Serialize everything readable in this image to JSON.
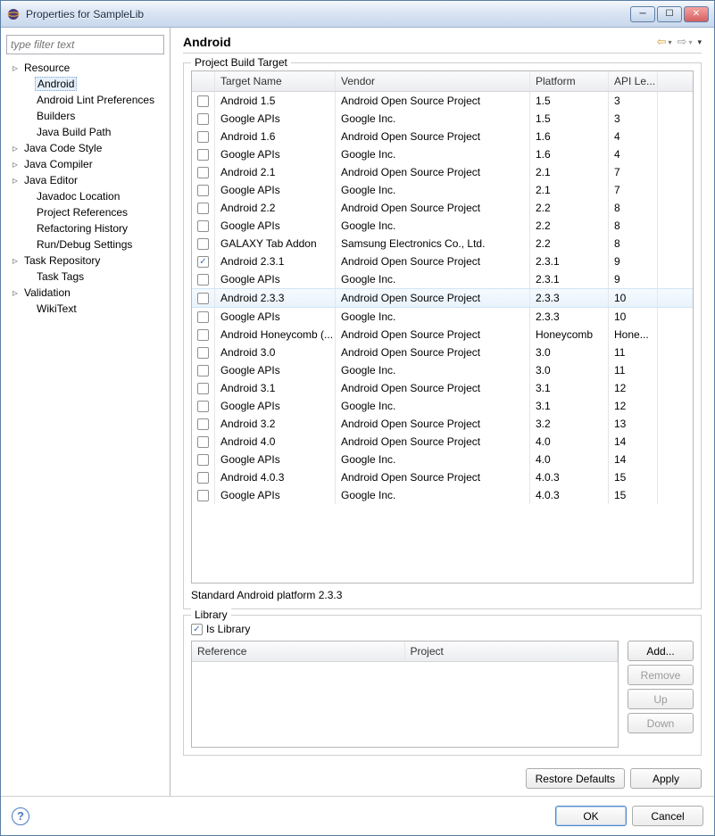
{
  "window": {
    "title": "Properties for SampleLib"
  },
  "sidebar": {
    "filter_placeholder": "type filter text",
    "items": [
      {
        "label": "Resource",
        "level": 1,
        "expand": true,
        "selected": false
      },
      {
        "label": "Android",
        "level": 2,
        "expand": false,
        "selected": true
      },
      {
        "label": "Android Lint Preferences",
        "level": 2,
        "expand": false,
        "selected": false
      },
      {
        "label": "Builders",
        "level": 2,
        "expand": false,
        "selected": false
      },
      {
        "label": "Java Build Path",
        "level": 2,
        "expand": false,
        "selected": false
      },
      {
        "label": "Java Code Style",
        "level": 1,
        "expand": true,
        "selected": false
      },
      {
        "label": "Java Compiler",
        "level": 1,
        "expand": true,
        "selected": false
      },
      {
        "label": "Java Editor",
        "level": 1,
        "expand": true,
        "selected": false
      },
      {
        "label": "Javadoc Location",
        "level": 2,
        "expand": false,
        "selected": false
      },
      {
        "label": "Project References",
        "level": 2,
        "expand": false,
        "selected": false
      },
      {
        "label": "Refactoring History",
        "level": 2,
        "expand": false,
        "selected": false
      },
      {
        "label": "Run/Debug Settings",
        "level": 2,
        "expand": false,
        "selected": false
      },
      {
        "label": "Task Repository",
        "level": 1,
        "expand": true,
        "selected": false
      },
      {
        "label": "Task Tags",
        "level": 2,
        "expand": false,
        "selected": false
      },
      {
        "label": "Validation",
        "level": 1,
        "expand": true,
        "selected": false
      },
      {
        "label": "WikiText",
        "level": 2,
        "expand": false,
        "selected": false
      }
    ]
  },
  "page": {
    "title": "Android",
    "build_target_group": "Project Build Target",
    "columns": {
      "target": "Target Name",
      "vendor": "Vendor",
      "platform": "Platform",
      "api": "API Le..."
    },
    "targets": [
      {
        "checked": false,
        "name": "Android 1.5",
        "vendor": "Android Open Source Project",
        "platform": "1.5",
        "api": "3",
        "hl": false
      },
      {
        "checked": false,
        "name": "Google APIs",
        "vendor": "Google Inc.",
        "platform": "1.5",
        "api": "3",
        "hl": false
      },
      {
        "checked": false,
        "name": "Android 1.6",
        "vendor": "Android Open Source Project",
        "platform": "1.6",
        "api": "4",
        "hl": false
      },
      {
        "checked": false,
        "name": "Google APIs",
        "vendor": "Google Inc.",
        "platform": "1.6",
        "api": "4",
        "hl": false
      },
      {
        "checked": false,
        "name": "Android 2.1",
        "vendor": "Android Open Source Project",
        "platform": "2.1",
        "api": "7",
        "hl": false
      },
      {
        "checked": false,
        "name": "Google APIs",
        "vendor": "Google Inc.",
        "platform": "2.1",
        "api": "7",
        "hl": false
      },
      {
        "checked": false,
        "name": "Android 2.2",
        "vendor": "Android Open Source Project",
        "platform": "2.2",
        "api": "8",
        "hl": false
      },
      {
        "checked": false,
        "name": "Google APIs",
        "vendor": "Google Inc.",
        "platform": "2.2",
        "api": "8",
        "hl": false
      },
      {
        "checked": false,
        "name": "GALAXY Tab Addon",
        "vendor": "Samsung Electronics Co., Ltd.",
        "platform": "2.2",
        "api": "8",
        "hl": false
      },
      {
        "checked": true,
        "name": "Android 2.3.1",
        "vendor": "Android Open Source Project",
        "platform": "2.3.1",
        "api": "9",
        "hl": false
      },
      {
        "checked": false,
        "name": "Google APIs",
        "vendor": "Google Inc.",
        "platform": "2.3.1",
        "api": "9",
        "hl": false
      },
      {
        "checked": false,
        "name": "Android 2.3.3",
        "vendor": "Android Open Source Project",
        "platform": "2.3.3",
        "api": "10",
        "hl": true
      },
      {
        "checked": false,
        "name": "Google APIs",
        "vendor": "Google Inc.",
        "platform": "2.3.3",
        "api": "10",
        "hl": false
      },
      {
        "checked": false,
        "name": "Android Honeycomb (...",
        "vendor": "Android Open Source Project",
        "platform": "Honeycomb",
        "api": "Hone...",
        "hl": false
      },
      {
        "checked": false,
        "name": "Android 3.0",
        "vendor": "Android Open Source Project",
        "platform": "3.0",
        "api": "11",
        "hl": false
      },
      {
        "checked": false,
        "name": "Google APIs",
        "vendor": "Google Inc.",
        "platform": "3.0",
        "api": "11",
        "hl": false
      },
      {
        "checked": false,
        "name": "Android 3.1",
        "vendor": "Android Open Source Project",
        "platform": "3.1",
        "api": "12",
        "hl": false
      },
      {
        "checked": false,
        "name": "Google APIs",
        "vendor": "Google Inc.",
        "platform": "3.1",
        "api": "12",
        "hl": false
      },
      {
        "checked": false,
        "name": "Android 3.2",
        "vendor": "Android Open Source Project",
        "platform": "3.2",
        "api": "13",
        "hl": false
      },
      {
        "checked": false,
        "name": "Android 4.0",
        "vendor": "Android Open Source Project",
        "platform": "4.0",
        "api": "14",
        "hl": false
      },
      {
        "checked": false,
        "name": "Google APIs",
        "vendor": "Google Inc.",
        "platform": "4.0",
        "api": "14",
        "hl": false
      },
      {
        "checked": false,
        "name": "Android 4.0.3",
        "vendor": "Android Open Source Project",
        "platform": "4.0.3",
        "api": "15",
        "hl": false
      },
      {
        "checked": false,
        "name": "Google APIs",
        "vendor": "Google Inc.",
        "platform": "4.0.3",
        "api": "15",
        "hl": false
      }
    ],
    "status_text": "Standard Android platform 2.3.3",
    "library_group": "Library",
    "is_library_label": "Is Library",
    "is_library_checked": true,
    "lib_columns": {
      "reference": "Reference",
      "project": "Project"
    },
    "buttons": {
      "add": "Add...",
      "remove": "Remove",
      "up": "Up",
      "down": "Down",
      "restore": "Restore Defaults",
      "apply": "Apply",
      "ok": "OK",
      "cancel": "Cancel"
    }
  }
}
